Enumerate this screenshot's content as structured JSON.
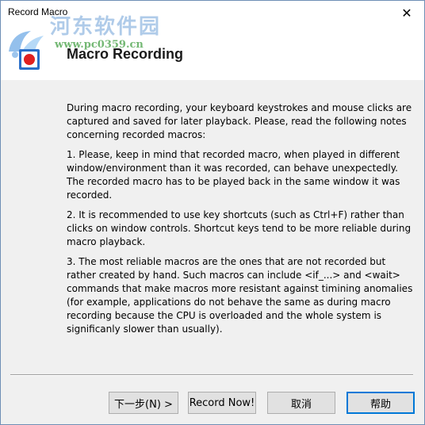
{
  "window": {
    "title": "Record Macro",
    "close_glyph": "✕"
  },
  "watermark": {
    "text": "河东软件园",
    "url": "www.pc0359.cn"
  },
  "header": {
    "title": "Macro Recording",
    "icon": "record-icon"
  },
  "content": {
    "paragraphs": [
      "During macro recording, your keyboard keystrokes and mouse clicks are captured and saved for later playback.  Please, read the following notes concerning recorded macros:",
      "1. Please, keep in mind that recorded macro, when played in different window/environment than it was recorded, can behave unexpectedly. The recorded macro has to be played back in the same window it was recorded.",
      "2. It is recommended to use key shortcuts (such as Ctrl+F) rather than clicks on window controls.  Shortcut keys tend to be more reliable during macro playback.",
      "3. The most reliable macros are the ones that are not recorded but rather created by hand.  Such macros can include <if_...> and <wait> commands that make macros more resistant against timining anomalies (for example, applications do not behave the same as during macro recording because the CPU is overloaded and the whole system is significanly slower than usually)."
    ]
  },
  "buttons": {
    "next": "下一步(N) >",
    "record_now": "Record Now!",
    "cancel": "取消",
    "help": "帮助"
  },
  "colors": {
    "accent": "#0078d7",
    "record_red": "#e02020",
    "icon_blue": "#2a6fc9"
  }
}
